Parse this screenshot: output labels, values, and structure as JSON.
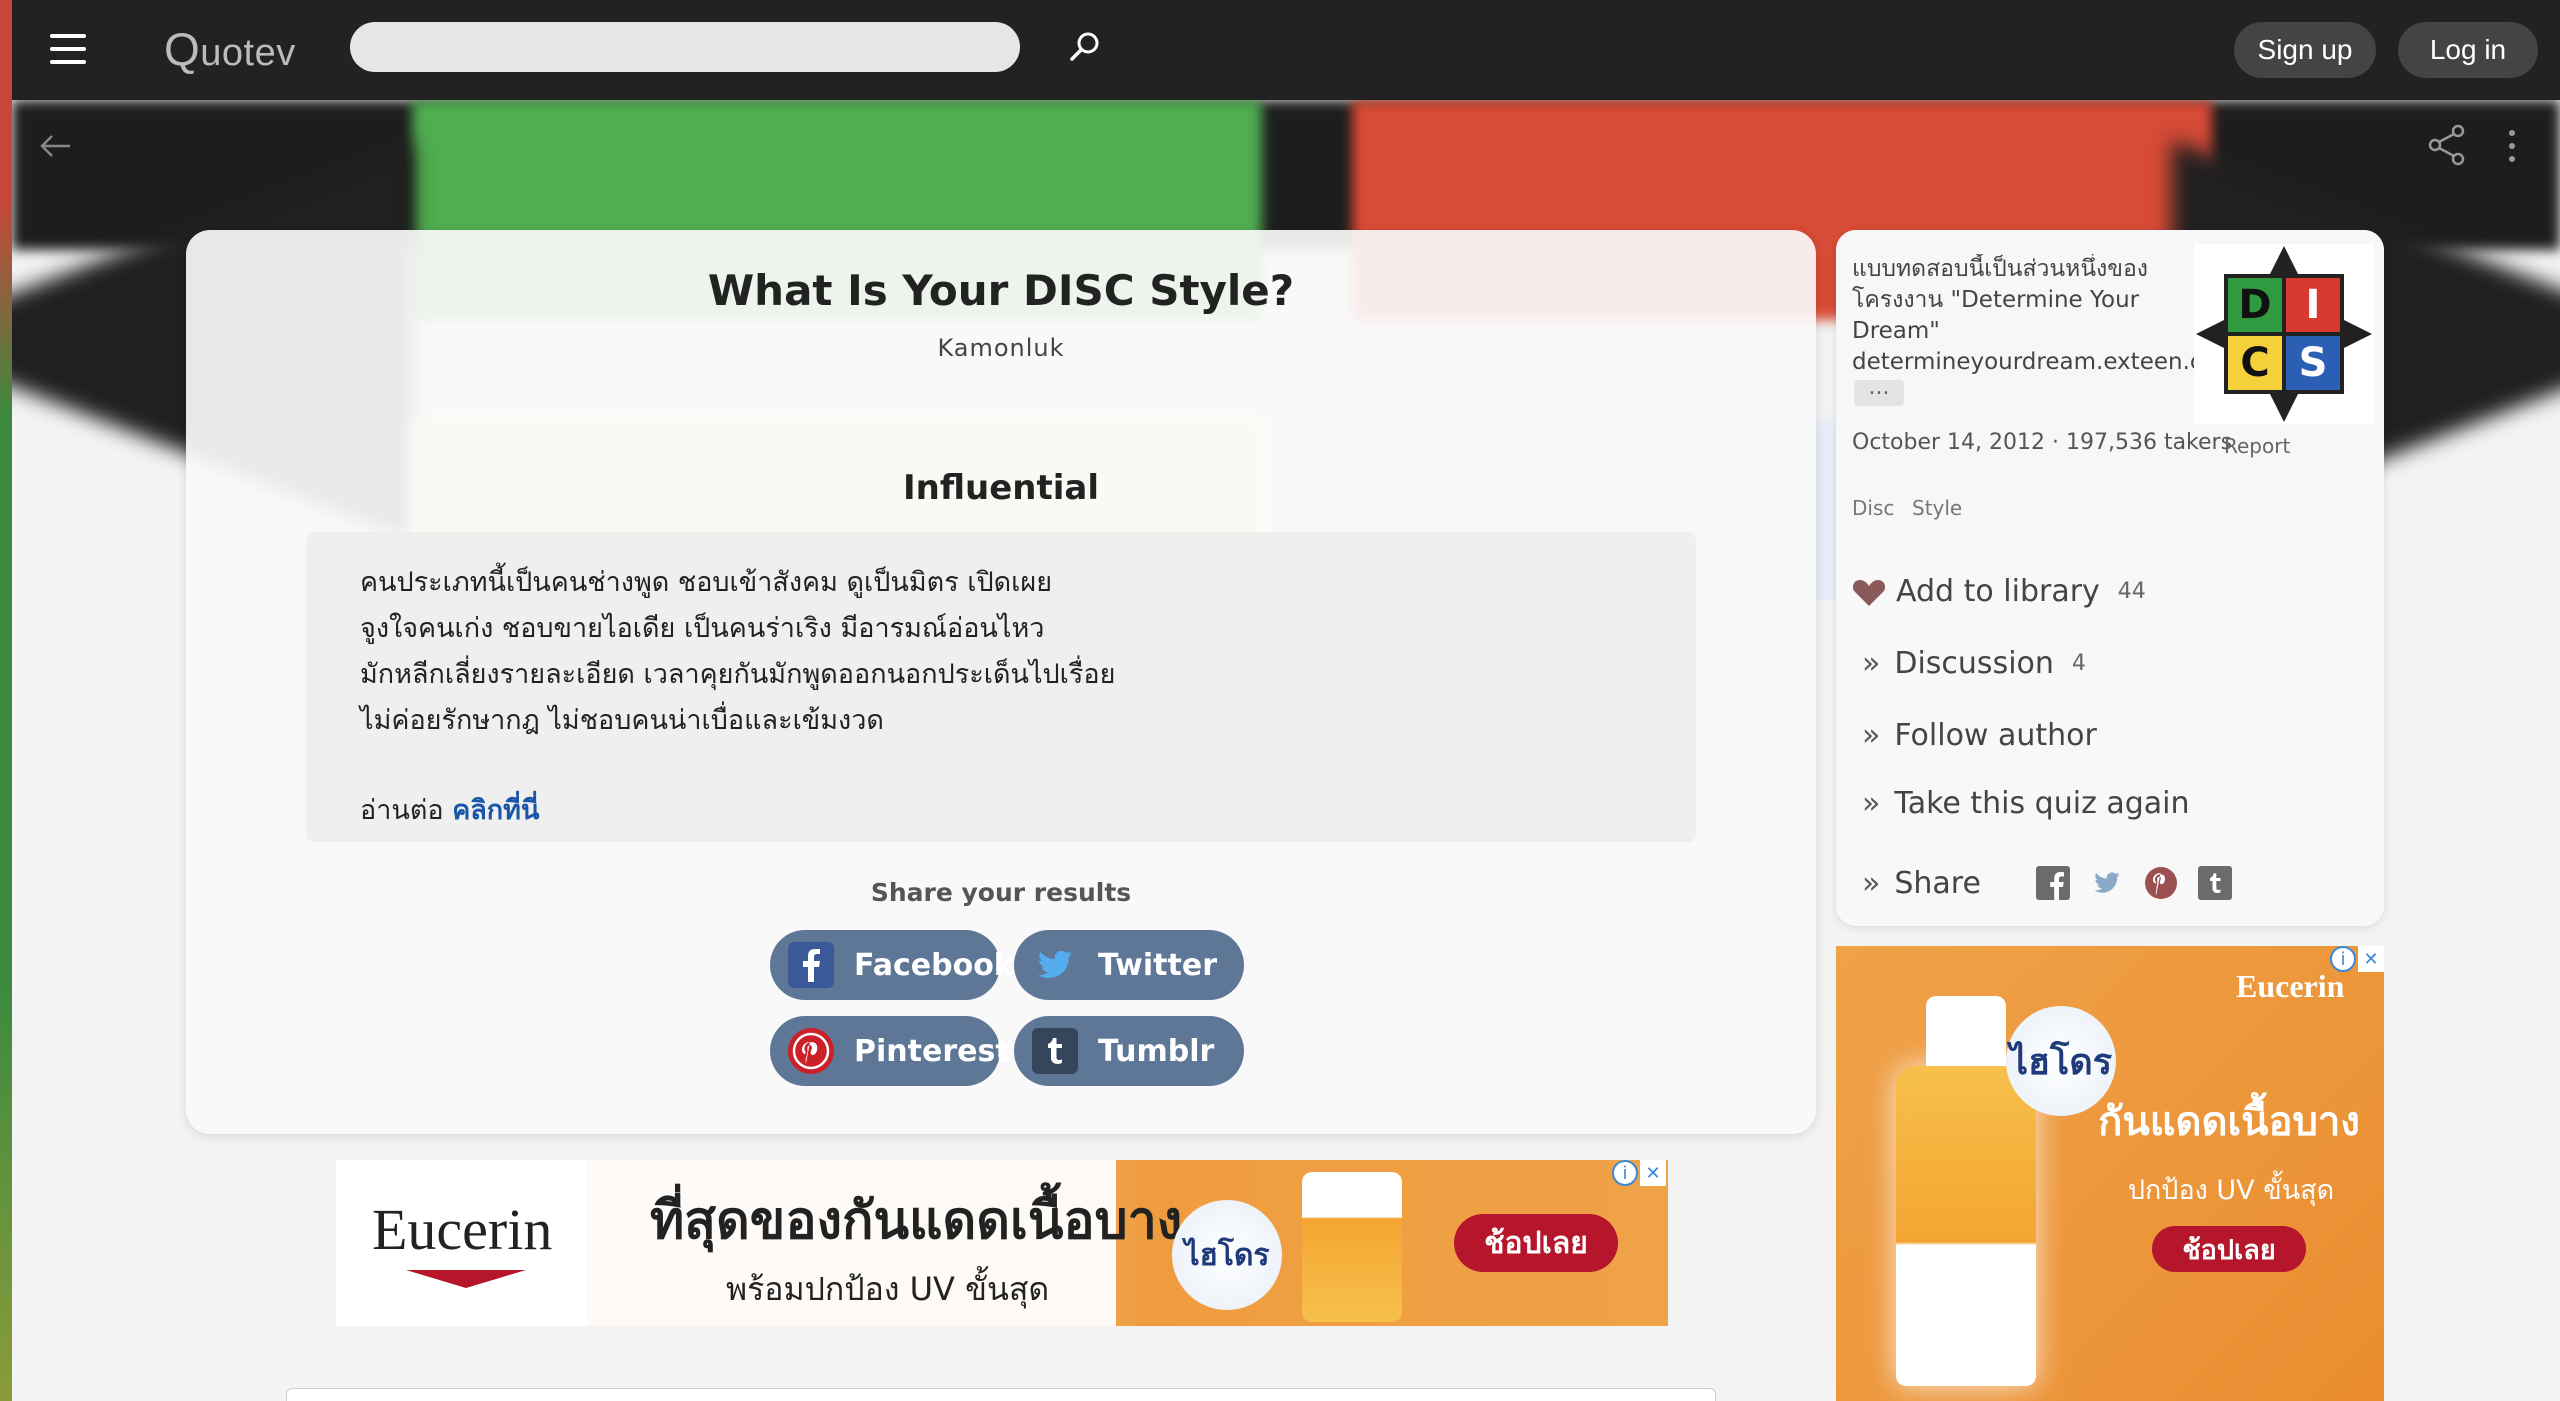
{
  "nav": {
    "logo": "Quotev",
    "logo_first": "Q",
    "logo_rest": "uotev",
    "search_placeholder": "",
    "signup_label": "Sign up",
    "login_label": "Log in"
  },
  "quiz": {
    "title": "What Is Your DISC Style?",
    "author": "Kamonluk",
    "result_title": "Influential",
    "result_lines": [
      "คนประเภทนี้เป็นคนช่างพูด ชอบเข้าสังคม ดูเป็นมิตร เปิดเผย",
      "จูงใจคนเก่ง ชอบขายไอเดีย เป็นคนร่าเริง มีอารมณ์อ่อนไหว",
      "มักหลีกเลี่ยงรายละเอียด เวลาคุยกันมักพูดออกนอกประเด็นไปเรื่อย",
      "ไม่ค่อยรักษากฎ ไม่ชอบคนน่าเบื่อและเข้มงวด"
    ],
    "read_more_prefix": "อ่านต่อ",
    "read_more_link": "คลิกที่นี่",
    "share_label": "Share your results",
    "share_buttons": {
      "facebook": "Facebook",
      "twitter": "Twitter",
      "pinterest": "Pinterest",
      "tumblr": "Tumblr"
    }
  },
  "sidebar": {
    "description_lines": [
      "แบบทดสอบนี้เป็นส่วนหนึ่งของ",
      "โครงงาน \"Determine Your",
      "Dream\"",
      "determineyourdream.exteen.c"
    ],
    "ellipsis": "...",
    "logo_letters": [
      "D",
      "I",
      "C",
      "S"
    ],
    "meta": "October 14, 2012 · 197,536 takers",
    "report_label": "Report",
    "tags": [
      "Disc",
      "Style"
    ],
    "actions": {
      "library": "Add to library",
      "library_count": "44",
      "discussion": "Discussion",
      "discussion_count": "4",
      "follow": "Follow author",
      "again": "Take this quiz again",
      "share": "Share"
    },
    "chevron": "»"
  },
  "ads": {
    "side": {
      "brand": "Eucerin",
      "cloud": "ไฮโดร",
      "headline": "กันแดดเนื้อบาง",
      "sub": "ปกป้อง UV ขั้นสุด",
      "cta": "ช้อปเลย"
    },
    "banner": {
      "brand": "Eucerin",
      "headline": "ที่สุดของกันแดดเนื้อบาง",
      "sub": "พร้อมปกป้อง UV ขั้นสุด",
      "cloud": "ไฮโดร",
      "cta": "ช้อปเลย"
    },
    "info_icon": "i",
    "close_icon": "✕"
  },
  "colors": {
    "disc_d": "#2f9a3f",
    "disc_i": "#d83a2f",
    "disc_c": "#f4d03a",
    "disc_s": "#2b5fb3",
    "share_button": "#5e7796",
    "link": "#1a56a8"
  }
}
